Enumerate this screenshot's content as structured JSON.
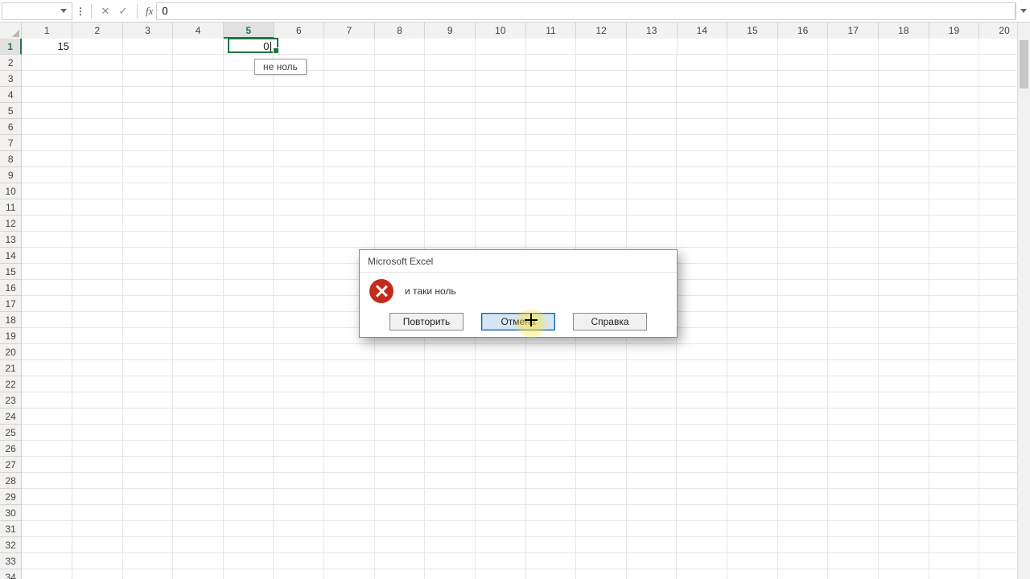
{
  "formula_bar": {
    "name_box": "",
    "input_value": "0",
    "fx_label": "fx"
  },
  "grid": {
    "num_cols": 20,
    "num_rows": 34,
    "active_col_index": 5,
    "active_row_index": 1,
    "a1_value": "15",
    "active_cell_value": "0",
    "tooltip_text": "не ноль"
  },
  "dialog": {
    "title": "Microsoft Excel",
    "message": "и таки ноль",
    "buttons": {
      "retry": "Повторить",
      "cancel": "Отмена",
      "help": "Справка"
    }
  }
}
